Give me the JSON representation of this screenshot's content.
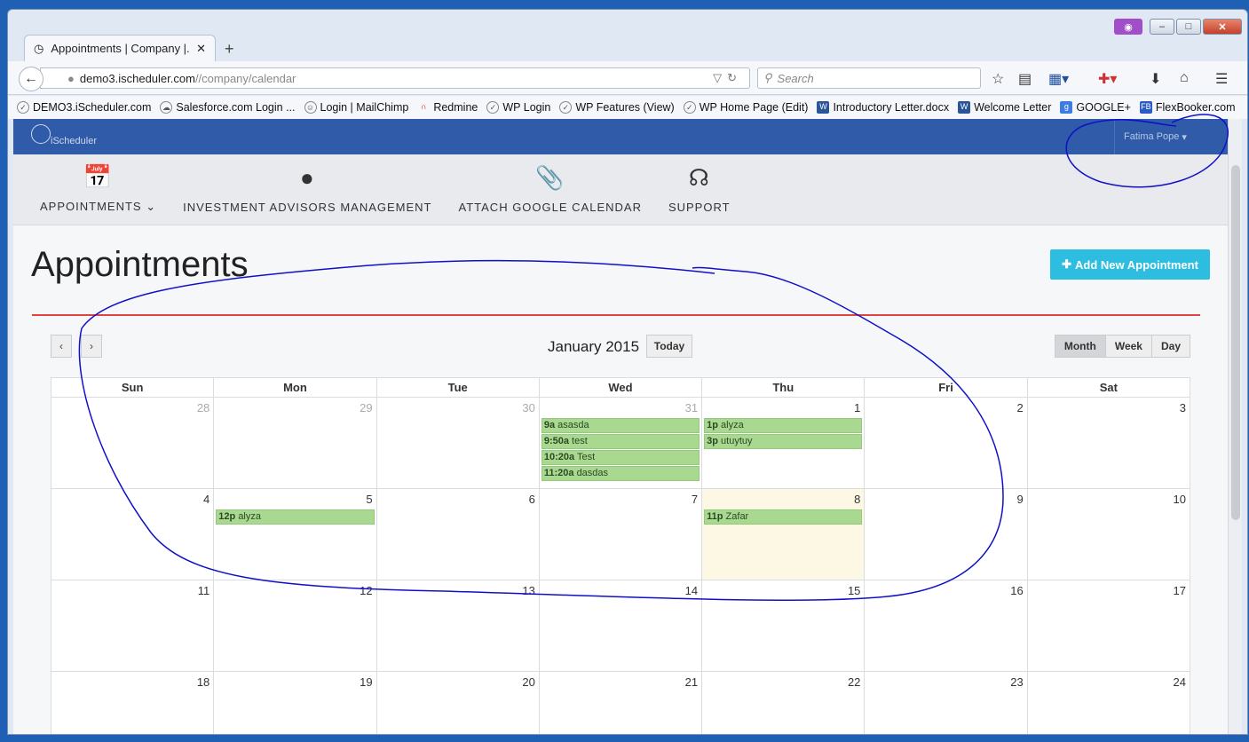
{
  "browser": {
    "tab_title": "Appointments | Company |...",
    "url_host": "demo3.ischeduler.com",
    "url_path": "//company/calendar",
    "search_placeholder": "Search",
    "bookmarks": [
      "DEMO3.iScheduler.com",
      "Salesforce.com Login ...",
      "Login | MailChimp",
      "Redmine",
      "WP Login",
      "WP Features (View)",
      "WP Home Page (Edit)",
      "Introductory Letter.docx",
      "Welcome Letter",
      "GOOGLE+",
      "FlexBooker.com"
    ]
  },
  "app": {
    "logo_text": "iScheduler",
    "user_name": "Fatima Pope",
    "menu": [
      {
        "label": "APPOINTMENTS",
        "icon": "calendar-icon"
      },
      {
        "label": "INVESTMENT ADVISORS MANAGEMENT",
        "icon": "user-icon"
      },
      {
        "label": "ATTACH GOOGLE CALENDAR",
        "icon": "paperclip-icon"
      },
      {
        "label": "SUPPORT",
        "icon": "headset-icon"
      }
    ],
    "page_title": "Appointments",
    "add_button": "Add New Appointment"
  },
  "calendar": {
    "title": "January 2015",
    "today_label": "Today",
    "views": [
      "Month",
      "Week",
      "Day"
    ],
    "active_view": "Month",
    "weekdays": [
      "Sun",
      "Mon",
      "Tue",
      "Wed",
      "Thu",
      "Fri",
      "Sat"
    ],
    "weeks": [
      [
        {
          "d": "28",
          "other": true
        },
        {
          "d": "29",
          "other": true
        },
        {
          "d": "30",
          "other": true
        },
        {
          "d": "31",
          "other": true,
          "events": [
            {
              "time": "9a",
              "title": "asasda"
            },
            {
              "time": "9:50a",
              "title": "test"
            },
            {
              "time": "10:20a",
              "title": "Test"
            },
            {
              "time": "11:20a",
              "title": "dasdas"
            }
          ]
        },
        {
          "d": "1",
          "events": [
            {
              "time": "1p",
              "title": "alyza"
            },
            {
              "time": "3p",
              "title": "utuytuy"
            }
          ]
        },
        {
          "d": "2"
        },
        {
          "d": "3"
        }
      ],
      [
        {
          "d": "4"
        },
        {
          "d": "5",
          "events": [
            {
              "time": "12p",
              "title": "alyza"
            }
          ]
        },
        {
          "d": "6"
        },
        {
          "d": "7"
        },
        {
          "d": "8",
          "today": true,
          "events": [
            {
              "time": "11p",
              "title": "Zafar"
            }
          ]
        },
        {
          "d": "9"
        },
        {
          "d": "10"
        }
      ],
      [
        {
          "d": "11"
        },
        {
          "d": "12"
        },
        {
          "d": "13"
        },
        {
          "d": "14"
        },
        {
          "d": "15"
        },
        {
          "d": "16"
        },
        {
          "d": "17"
        }
      ],
      [
        {
          "d": "18"
        },
        {
          "d": "19"
        },
        {
          "d": "20"
        },
        {
          "d": "21"
        },
        {
          "d": "22"
        },
        {
          "d": "23"
        },
        {
          "d": "24"
        }
      ]
    ]
  },
  "colors": {
    "appbar": "#2f5ba9",
    "accent_button": "#2dbde0",
    "event": "#a9d890",
    "today": "#fcf8e3",
    "annotation": "#1010c8"
  }
}
